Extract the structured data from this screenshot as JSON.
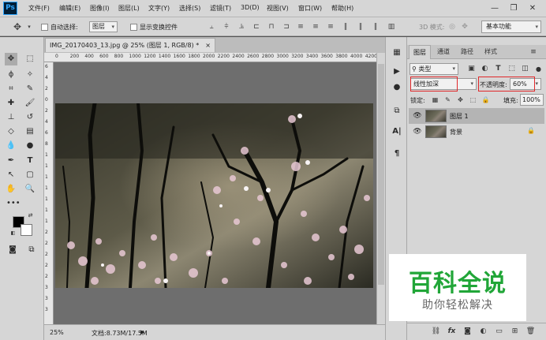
{
  "app": {
    "logo": "Ps"
  },
  "menu": {
    "items": [
      "文件(F)",
      "编辑(E)",
      "图像(I)",
      "图层(L)",
      "文字(Y)",
      "选择(S)",
      "滤镜(T)",
      "3D(D)",
      "视图(V)",
      "窗口(W)",
      "帮助(H)"
    ]
  },
  "window_controls": {
    "minimize": "—",
    "restore": "❐",
    "close": "✕"
  },
  "options_bar": {
    "auto_select_label": "自动选择:",
    "auto_select_value": "图层",
    "show_transform_label": "显示变换控件",
    "mode_3d_label": "3D 模式:",
    "workspace": "基本功能"
  },
  "document": {
    "tab_title": "IMG_20170403_13.jpg @ 25% (图层 1, RGB/8) *",
    "tab_close": "×",
    "ruler_h": [
      "0",
      "200",
      "400",
      "600",
      "800",
      "1000",
      "1200",
      "1400",
      "1600",
      "1800",
      "2000",
      "2200",
      "2400",
      "2600",
      "2800",
      "3000",
      "3200",
      "3400",
      "3600",
      "3800",
      "4000",
      "4200",
      "4400"
    ],
    "ruler_v": [
      "6",
      "4",
      "2",
      "0",
      "2",
      "4",
      "6",
      "8",
      "1",
      "1",
      "1",
      "1",
      "1",
      "1",
      "1",
      "2",
      "2",
      "2",
      "2",
      "2",
      "3",
      "3",
      "3"
    ]
  },
  "status": {
    "zoom": "25%",
    "doc_info": "文档:8.73M/17.5M"
  },
  "layers_panel": {
    "tabs": [
      "图层",
      "通道",
      "路径",
      "样式"
    ],
    "filter_kind": "类型",
    "blend_mode": "线性加深",
    "opacity_label": "不透明度:",
    "opacity_value": "60%",
    "lock_label": "锁定:",
    "fill_label": "填充:",
    "fill_value": "100%",
    "layers": [
      {
        "name": "图层 1",
        "selected": true,
        "locked": false
      },
      {
        "name": "背景",
        "selected": false,
        "locked": true
      }
    ],
    "bottom_icons": [
      "link-icon",
      "fx-icon",
      "mask-icon",
      "adjustment-icon",
      "group-icon",
      "new-layer-icon",
      "trash-icon"
    ],
    "fx_text": "fx"
  },
  "watermark": {
    "title": "百科全说",
    "subtitle": "助你轻松解决"
  },
  "colors": {
    "accent_red": "#e0282a",
    "watermark_green": "#21a638"
  }
}
